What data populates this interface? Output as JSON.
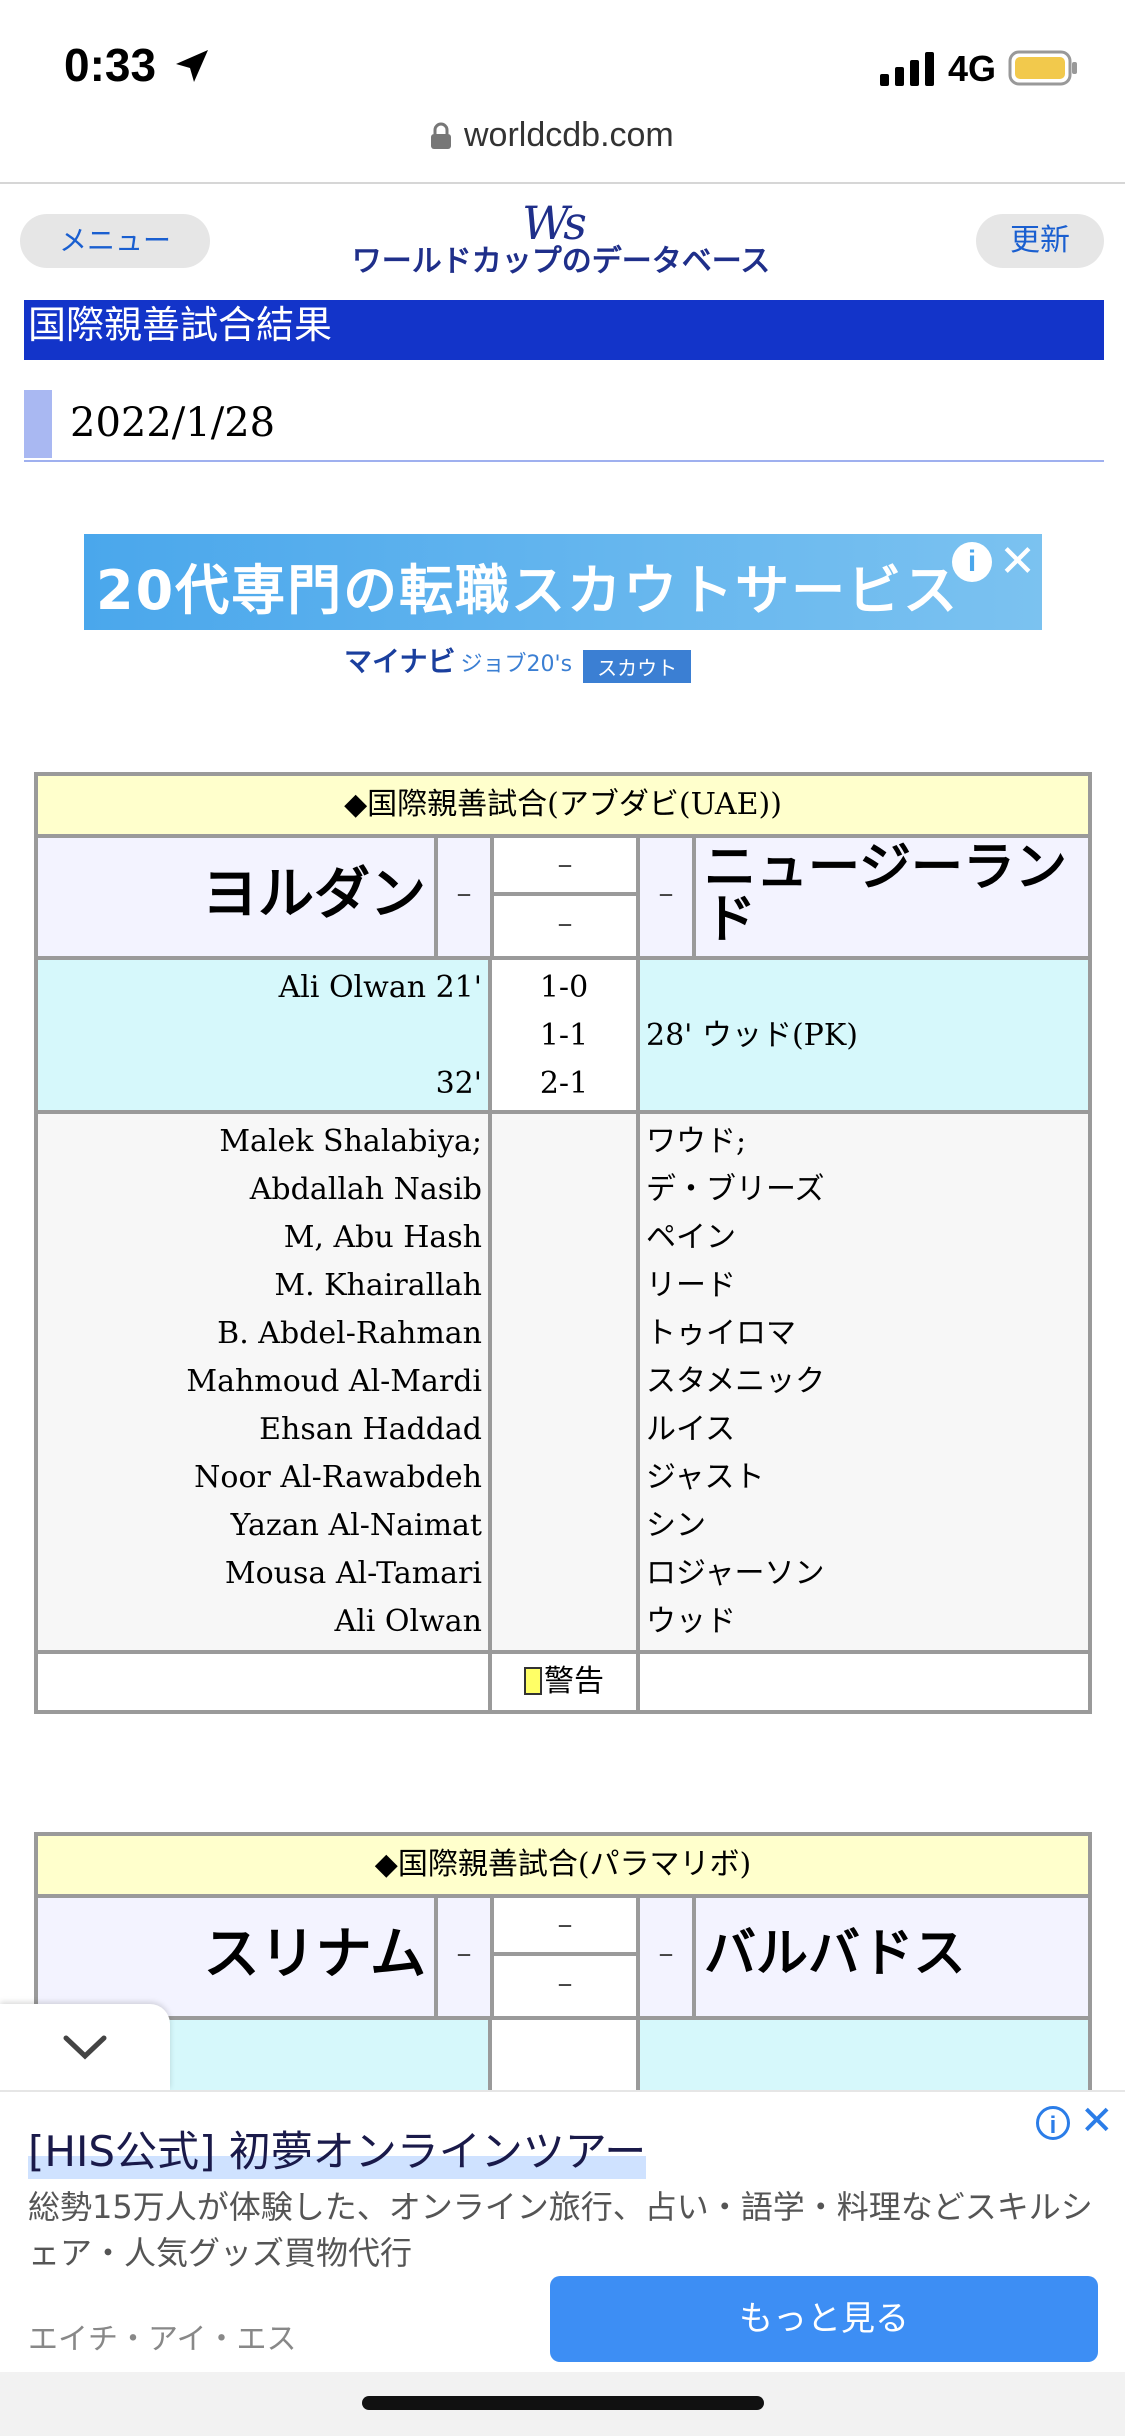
{
  "status_bar": {
    "time": "0:33",
    "network": "4G"
  },
  "browser": {
    "url": "worldcdb.com"
  },
  "site": {
    "menu_label": "メニュー",
    "refresh_label": "更新",
    "logo_mark": "Ws",
    "logo_text": "ワールドカップのデータベース",
    "section_title": "国際親善試合結果",
    "date": "2022/1/28"
  },
  "ad_top": {
    "headline": "20代専門の転職スカウトサービス",
    "brand": "マイナビ",
    "brand_sub": "ジョブ20's",
    "brand_badge": "スカウト"
  },
  "matches": [
    {
      "header": "◆国際親善試合(アブダビ(UAE))",
      "home": "ヨルダン",
      "away": "ニュージーランド",
      "dash": "–",
      "score_top": "–",
      "score_bottom": "–",
      "goals": [
        {
          "home": "Ali Olwan 21'",
          "score": "1-0",
          "away": ""
        },
        {
          "home": "",
          "score": "1-1",
          "away": "28' ウッド(PK)"
        },
        {
          "home": "32'",
          "score": "2-1",
          "away": ""
        }
      ],
      "home_lineup": [
        "Malek Shalabiya;",
        "Abdallah Nasib",
        "M, Abu Hash",
        "M. Khairallah",
        "B. Abdel-Rahman",
        "Mahmoud Al-Mardi",
        "Ehsan Haddad",
        "Noor Al-Rawabdeh",
        "Yazan Al-Naimat",
        "Mousa Al-Tamari",
        "Ali Olwan"
      ],
      "away_lineup": [
        "ワウド;",
        "デ・ブリーズ",
        "ペイン",
        "リード",
        "トゥイロマ",
        "スタメニック",
        "ルイス",
        "ジャスト",
        "シン",
        "ロジャーソン",
        "ウッド"
      ],
      "cards_label": "警告"
    },
    {
      "header": "◆国際親善試合(パラマリボ)",
      "home": "スリナム",
      "away": "バルバドス",
      "dash": "–",
      "score_top": "–",
      "score_bottom": "–"
    }
  ],
  "ad_bottom": {
    "title": "[HIS公式] 初夢オンラインツアー",
    "description": "総勢15万人が体験した、オンライン旅行、占い・語学・料理などスキルシェア・人気グッズ買物代行",
    "advertiser": "エイチ・アイ・エス",
    "cta": "もっと見る"
  },
  "colors": {
    "accent_blue": "#1334c9",
    "header_yellow": "#ffffcc",
    "goal_cyan": "#d6f8fb",
    "cta_blue": "#3d8ef4"
  }
}
